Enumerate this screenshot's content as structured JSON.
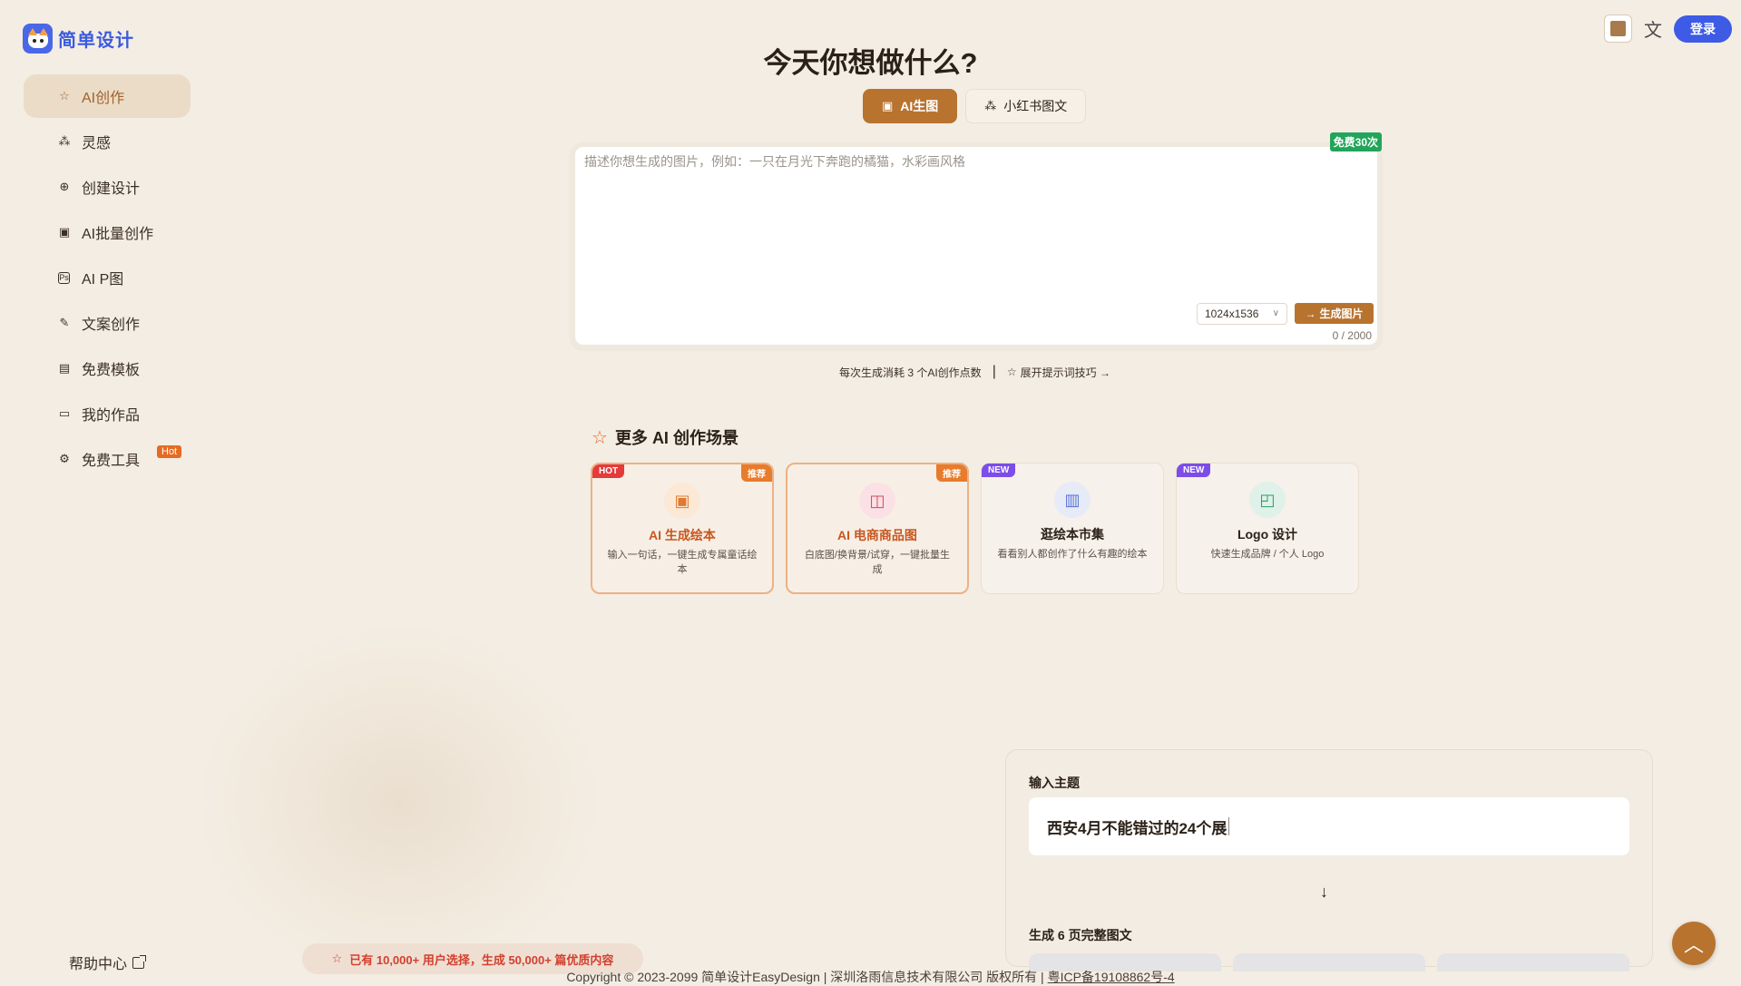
{
  "brand": {
    "name": "简单设计"
  },
  "sidebar": {
    "items": [
      {
        "label": "AI创作",
        "icon": "star-icon",
        "active": true
      },
      {
        "label": "灵感",
        "icon": "sparkle-icon"
      },
      {
        "label": "创建设计",
        "icon": "plus-circle-icon"
      },
      {
        "label": "AI批量创作",
        "icon": "image-icon"
      },
      {
        "label": "AI P图",
        "icon": "ps-icon"
      },
      {
        "label": "文案创作",
        "icon": "edit-icon"
      },
      {
        "label": "免费模板",
        "icon": "template-icon"
      },
      {
        "label": "我的作品",
        "icon": "folder-icon"
      },
      {
        "label": "免费工具",
        "icon": "gear-icon",
        "badge": "Hot"
      }
    ],
    "help": "帮助中心"
  },
  "header": {
    "login": "登录"
  },
  "main": {
    "headline": "今天你想做什么?",
    "tabs": [
      {
        "label": "AI生图",
        "active": true
      },
      {
        "label": "小红书图文"
      }
    ],
    "prompt": {
      "placeholder": "描述你想生成的图片，例如：一只在月光下奔跑的橘猫，水彩画风格",
      "free_badge": "免费30次",
      "size": "1024x1536",
      "generate": "生成图片",
      "count": "0 / 2000"
    },
    "cost_note": "每次生成消耗 3 个AI创作点数",
    "tips_link": "展开提示词技巧 →"
  },
  "scenes": {
    "title": "更多 AI 创作场景",
    "cards": [
      {
        "title": "AI 生成绘本",
        "desc": "输入一句话，一键生成专属童话绘本",
        "tag_left": "HOT",
        "tag_right": "推荐"
      },
      {
        "title": "AI 电商商品图",
        "desc": "白底图/换背景/试穿，一键批量生成",
        "tag_right": "推荐"
      },
      {
        "title": "逛绘本市集",
        "desc": "看看别人都创作了什么有趣的绘本",
        "tag_left": "NEW"
      },
      {
        "title": "Logo 设计",
        "desc": "快速生成品牌 / 个人 Logo",
        "tag_left": "NEW"
      }
    ]
  },
  "stats_pill": "已有 10,000+ 用户选择，生成 50,000+ 篇优质内容",
  "demo": {
    "input_label": "输入主题",
    "input_value": "西安4月不能错过的24个展",
    "output_label": "生成 6 页完整图文"
  },
  "footer": {
    "copyright": "Copyright © 2023-2099 简单设计EasyDesign | 深圳洛雨信息技术有限公司 版权所有 | ",
    "icp": "粤ICP备19108862号-4"
  },
  "colors": {
    "accent": "#b8732f",
    "brand": "#3d5be4",
    "background": "#f4ede3"
  }
}
